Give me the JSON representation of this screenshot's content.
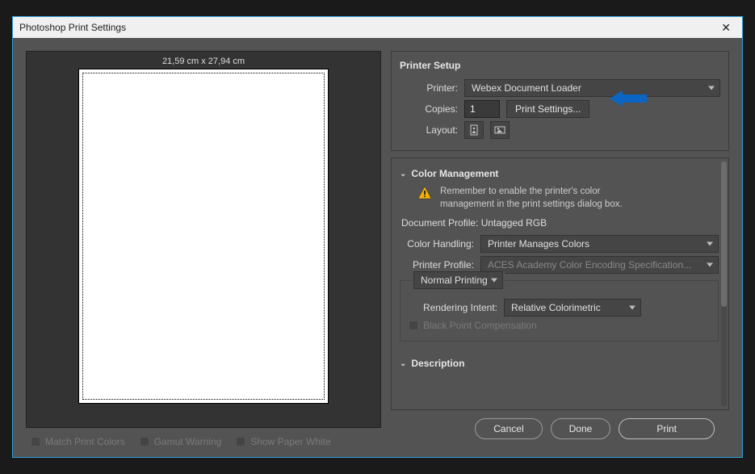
{
  "dialog": {
    "title": "Photoshop Print Settings"
  },
  "preview": {
    "dimensions": "21,59 cm x 27,94 cm",
    "opts": {
      "match_colors": "Match Print Colors",
      "gamut_warning": "Gamut Warning",
      "show_paper_white": "Show Paper White"
    }
  },
  "printer_setup": {
    "title": "Printer Setup",
    "printer_label": "Printer:",
    "printer_value": "Webex Document Loader",
    "copies_label": "Copies:",
    "copies_value": "1",
    "print_settings_btn": "Print Settings...",
    "layout_label": "Layout:"
  },
  "color_mgmt": {
    "title": "Color Management",
    "warning_l1": "Remember to enable the printer's color",
    "warning_l2": "management in the print settings dialog box.",
    "doc_profile": "Document Profile: Untagged RGB",
    "handling_label": "Color Handling:",
    "handling_value": "Printer Manages Colors",
    "printer_profile_label": "Printer Profile:",
    "printer_profile_value": "ACES Academy Color Encoding Specification...",
    "mode_value": "Normal Printing",
    "rendering_label": "Rendering Intent:",
    "rendering_value": "Relative Colorimetric",
    "black_point": "Black Point Compensation"
  },
  "description": {
    "title": "Description"
  },
  "buttons": {
    "cancel": "Cancel",
    "done": "Done",
    "print": "Print"
  }
}
